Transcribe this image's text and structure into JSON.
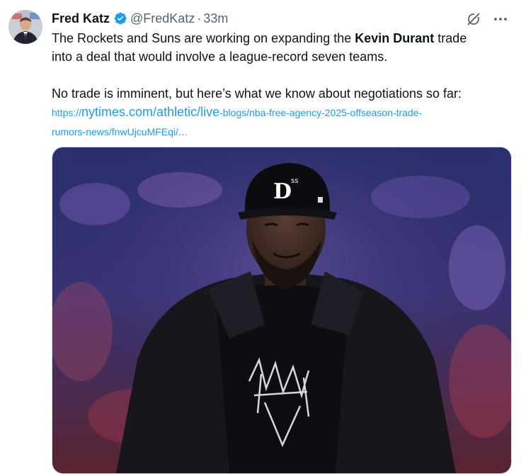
{
  "tweet": {
    "author_name": "Fred Katz",
    "handle": "@FredKatz",
    "separator": "·",
    "time": "33m",
    "text_line1_a": "The Rockets and Suns are working on expanding the ",
    "text_line1_bold": "Kevin Durant",
    "text_line1_b": " trade",
    "text_line2": "into a deal that would involve a league-record seven teams.",
    "text_line3": "No trade is imminent, but here’s what we know about negotiations so far:",
    "link": {
      "scheme": "https://",
      "domain": "nytimes.com/athletic/live",
      "path1": "-blogs/nba-free-agency-2025-offseason-trade-",
      "path2": "rumors-news/fnwUjcuMFEqi/…"
    },
    "media_alt": "photo"
  },
  "colors": {
    "text": "#0f1419",
    "secondary": "#536471",
    "link": "#1d9bf0",
    "verified": "#1d9bf0"
  },
  "icons": [
    "verified-badge-icon",
    "grok-icon",
    "more-icon"
  ]
}
